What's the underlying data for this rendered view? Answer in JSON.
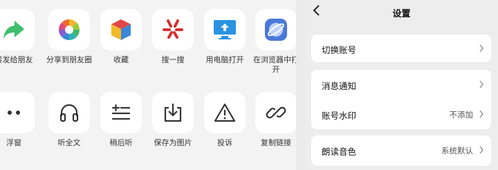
{
  "share_sheet": {
    "row1": [
      {
        "label": "转发给朋友",
        "icon": "forward-arrow-icon"
      },
      {
        "label": "分享到朋友圈",
        "icon": "moments-icon"
      },
      {
        "label": "收藏",
        "icon": "favorites-cube-icon"
      },
      {
        "label": "搜一搜",
        "icon": "search-sparkle-icon"
      },
      {
        "label": "用电脑打开",
        "icon": "open-on-computer-icon"
      },
      {
        "label": "在浏览器中打开",
        "icon": "browser-icon"
      }
    ],
    "row2": [
      {
        "label": "浮窗",
        "icon": "floating-window-icon"
      },
      {
        "label": "听全文",
        "icon": "headphones-icon"
      },
      {
        "label": "稍后听",
        "icon": "listen-later-icon"
      },
      {
        "label": "保存为图片",
        "icon": "save-image-icon"
      },
      {
        "label": "投诉",
        "icon": "warning-icon"
      },
      {
        "label": "复制链接",
        "icon": "link-icon"
      }
    ]
  },
  "settings": {
    "title": "设置",
    "rows": {
      "switch_account": {
        "label": "切换账号",
        "value": ""
      },
      "notifications": {
        "label": "消息通知",
        "value": ""
      },
      "watermark": {
        "label": "账号水印",
        "value": "不添加"
      },
      "read_voice": {
        "label": "朗读音色",
        "value": "系统默认"
      }
    }
  },
  "colors": {
    "forward_green": "#3fbf6b",
    "link_blue": "#3d6fd6",
    "favorites_red": "#e04848",
    "search_red": "#d62f2f",
    "computer_blue": "#2a93e0"
  }
}
